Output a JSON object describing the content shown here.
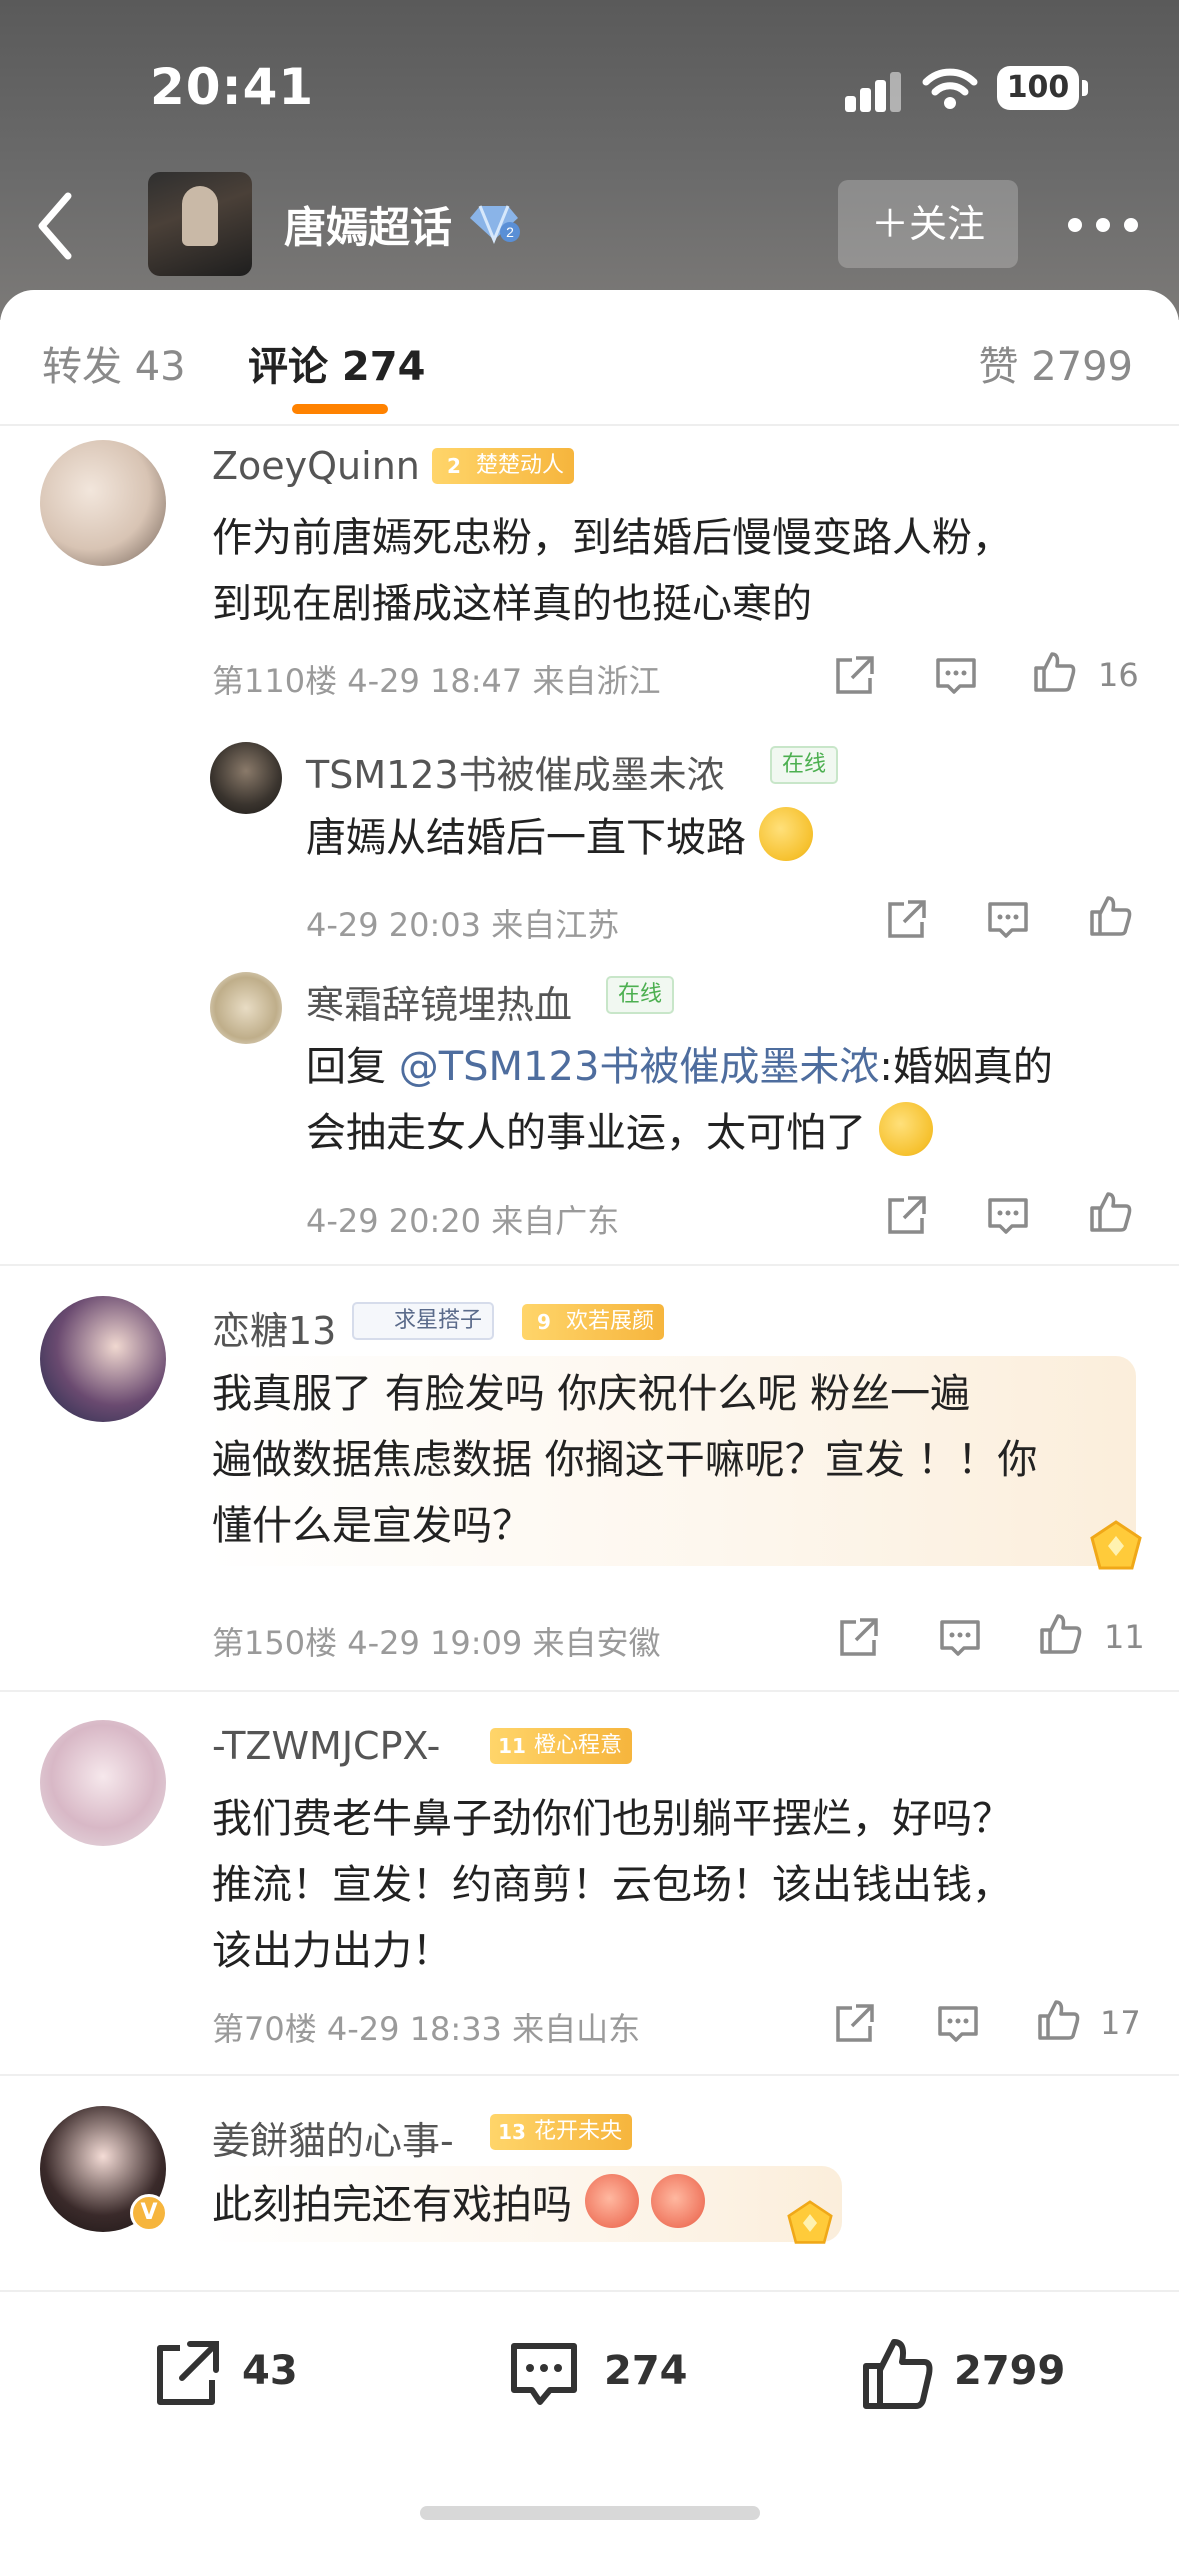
{
  "status_bar": {
    "time": "20:41",
    "battery": "100"
  },
  "header": {
    "topic_title": "唐嫣超话",
    "follow_label": "＋关注"
  },
  "tabs": {
    "forward": "转发 43",
    "comment": "评论 274",
    "like": "赞 2799"
  },
  "comments": [
    {
      "username": "ZoeyQuinn",
      "fan_level": "2",
      "fan_badge": "楚楚动人",
      "text_line1": "作为前唐嫣死忠粉，到结婚后慢慢变路人粉，",
      "text_line2": "到现在剧播成这样真的也挺心寒的",
      "meta": "第110楼 4-29 18:47 来自浙江",
      "like_count": "16",
      "replies": [
        {
          "username": "TSM123书被催成墨未浓",
          "online_badge": "在线",
          "text": "唐嫣从结婚后一直下坡路",
          "meta": "4-29 20:03 来自江苏"
        },
        {
          "username": "寒霜辞镜埋热血",
          "online_badge": "在线",
          "reply_prefix": "回复 ",
          "mention": "@TSM123书被催成墨未浓",
          "text_line1": ":婚姻真的",
          "text_line2": "会抽走女人的事业运，太可怕了",
          "meta": "4-29 20:20 来自广东"
        }
      ]
    },
    {
      "username": "恋糖13",
      "star_badge": "求星搭子",
      "fan_level": "9",
      "fan_badge": "欢若展颜",
      "text_line1": "我真服了 有脸发吗 你庆祝什么呢 粉丝一遍",
      "text_line2": "遍做数据焦虑数据 你搁这干嘛呢？宣发 ！！你",
      "text_line3": "懂什么是宣发吗？",
      "meta": "第150楼 4-29 19:09 来自安徽",
      "like_count": "11"
    },
    {
      "username": "-TZWMJCPX-",
      "fan_level": "11",
      "fan_badge": "橙心程意",
      "text_line1": "我们费老牛鼻子劲你们也别躺平摆烂，好吗？",
      "text_line2": "推流！宣发！约商剪！云包场！该出钱出钱，",
      "text_line3": "该出力出力！",
      "meta": "第70楼 4-29 18:33 来自山东",
      "like_count": "17"
    },
    {
      "username": "姜餅貓的心事-",
      "fan_level": "13",
      "fan_badge": "花开未央",
      "text": "此刻拍完还有戏拍吗"
    }
  ],
  "bottom_bar": {
    "forward_count": "43",
    "comment_count": "274",
    "like_count": "2799"
  },
  "colors": {
    "accent_orange": "#ff8200",
    "mention_blue": "#4e6d9e",
    "online_green": "#4caf50"
  },
  "icons": [
    "back-arrow-icon",
    "diamond-badge-icon",
    "more-icon",
    "share-icon",
    "comment-icon",
    "like-icon",
    "crown-icon"
  ]
}
